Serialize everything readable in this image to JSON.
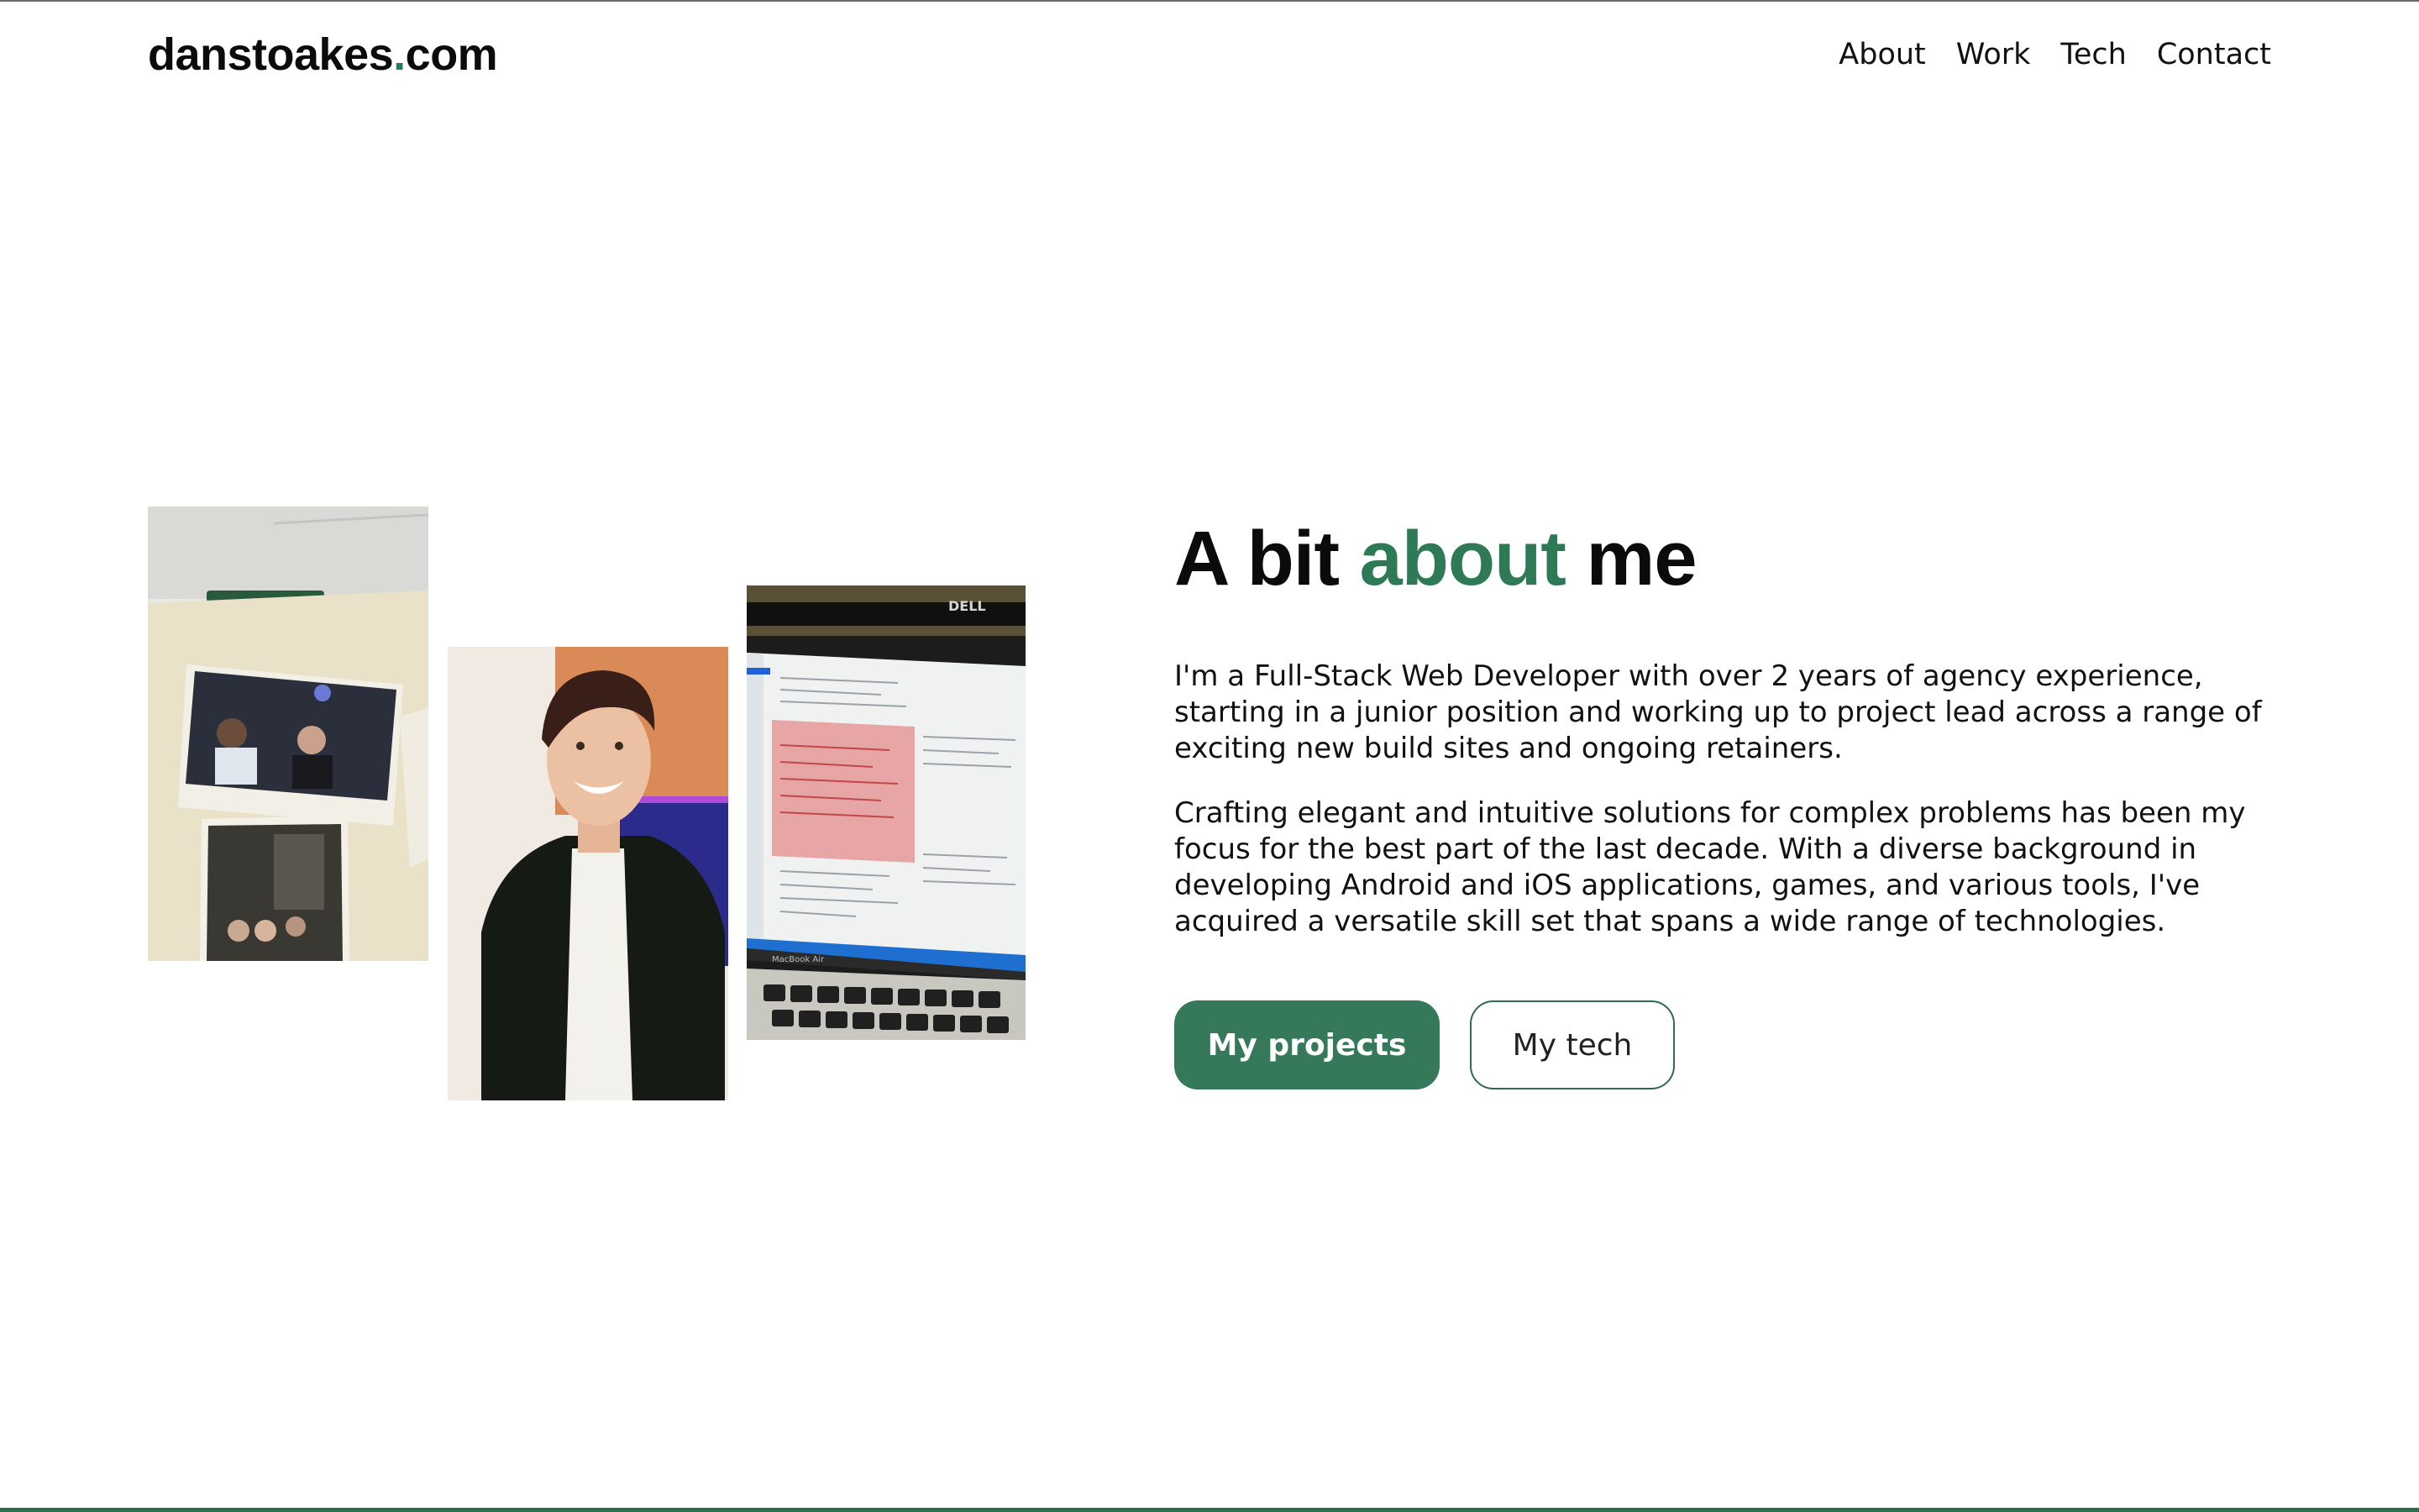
{
  "site": {
    "logo_name": "danstoakes",
    "logo_dot": ".",
    "logo_tld": "com"
  },
  "nav": {
    "items": [
      {
        "label": "About"
      },
      {
        "label": "Work"
      },
      {
        "label": "Tech"
      },
      {
        "label": "Contact"
      }
    ]
  },
  "about": {
    "heading_prefix": "A bit ",
    "heading_accent": "about",
    "heading_suffix": " me",
    "paragraphs": [
      "I'm a Full-Stack Web Developer with over 2 years of agency experience, starting in a junior position and working up to project lead across a range of exciting new build sites and ongoing retainers.",
      "Crafting elegant and intuitive solutions for complex problems has been my focus for the best part of the last decade. With a diverse background in developing Android and iOS applications, games, and various tools, I've acquired a versatile skill set that spans a wide range of technologies."
    ],
    "buttons": {
      "primary": "My projects",
      "secondary": "My tech"
    }
  },
  "photos": {
    "laptop_brand": "DELL",
    "laptop_model": "MacBook Air"
  },
  "colors": {
    "accent": "#2f7a56",
    "button_primary": "#35795a",
    "text": "#111111",
    "background": "#ffffff"
  }
}
